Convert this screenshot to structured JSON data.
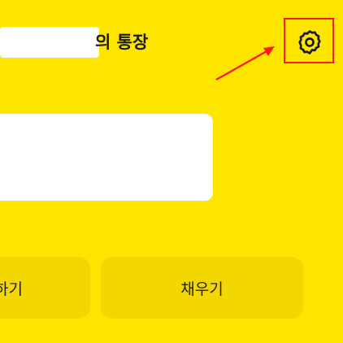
{
  "header": {
    "title_suffix": "의 통장",
    "settings_icon": "gear-icon"
  },
  "actions": {
    "left_label_partial": "하기",
    "fill_label": "채우기"
  },
  "colors": {
    "background": "#FEE500",
    "button_bg": "#F2D800",
    "annotation": "#FF1A1A"
  }
}
